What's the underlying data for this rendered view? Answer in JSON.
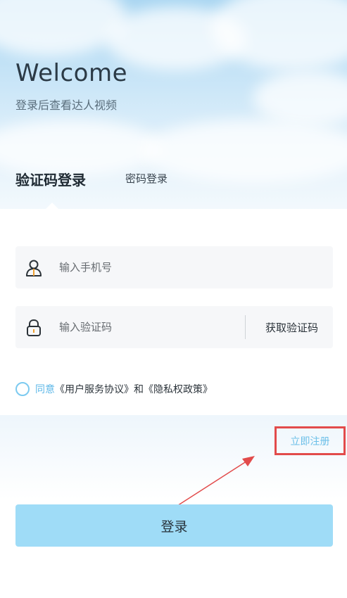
{
  "header": {
    "welcome": "Welcome",
    "subtitle": "登录后查看达人视频"
  },
  "tabs": [
    {
      "label": "验证码登录",
      "active": true
    },
    {
      "label": "密码登录",
      "active": false
    }
  ],
  "form": {
    "phone": {
      "placeholder": "输入手机号",
      "value": "",
      "icon": "user-icon"
    },
    "code": {
      "placeholder": "输入验证码",
      "value": "",
      "icon": "lock-icon"
    },
    "get_code_label": "获取验证码"
  },
  "agreement": {
    "checked": false,
    "agree_word": "同意",
    "user_agreement": "《用户服务协议》",
    "and_word": "和",
    "privacy_policy": "《隐私权政策》"
  },
  "register_label": "立即注册",
  "login_label": "登录",
  "colors": {
    "accent": "#9fdcf7",
    "link": "#6bbfe8",
    "highlight": "#e24b4b"
  }
}
